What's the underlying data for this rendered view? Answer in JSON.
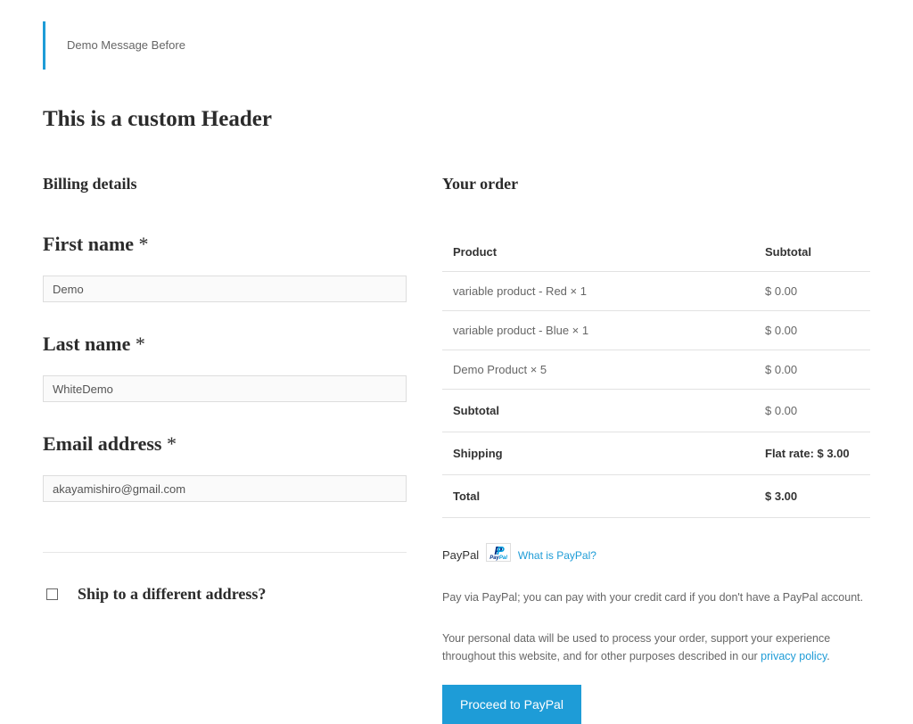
{
  "message_before": "Demo Message Before",
  "page_header": "This is a custom Header",
  "billing": {
    "heading": "Billing details",
    "first_name": {
      "label": "First name",
      "required": "*",
      "value": "Demo"
    },
    "last_name": {
      "label": "Last name",
      "required": "*",
      "value": "WhiteDemo"
    },
    "email": {
      "label": "Email address",
      "required": "*",
      "value": "akayamishiro@gmail.com"
    }
  },
  "ship_different": {
    "label": "Ship to a different address?",
    "checked": false
  },
  "order": {
    "heading": "Your order",
    "columns": {
      "product": "Product",
      "subtotal": "Subtotal"
    },
    "items": [
      {
        "name": "variable product - Red  × 1",
        "subtotal": "$ 0.00"
      },
      {
        "name": "variable product - Blue  × 1",
        "subtotal": "$ 0.00"
      },
      {
        "name": "Demo Product  × 5",
        "subtotal": "$ 0.00"
      }
    ],
    "totals": {
      "subtotal": {
        "label": "Subtotal",
        "value": "$ 0.00"
      },
      "shipping": {
        "label": "Shipping",
        "value": "Flat rate: $ 3.00"
      },
      "total": {
        "label": "Total",
        "value": "$ 3.00"
      }
    }
  },
  "payment": {
    "method_label": "PayPal",
    "what_is_link": "What is PayPal?",
    "desc": "Pay via PayPal; you can pay with your credit card if you don't have a PayPal account."
  },
  "privacy": {
    "text": "Your personal data will be used to process your order, support your experience throughout this website, and for other purposes described in our ",
    "link_text": "privacy policy",
    "suffix": "."
  },
  "submit_label": "Proceed to PayPal"
}
